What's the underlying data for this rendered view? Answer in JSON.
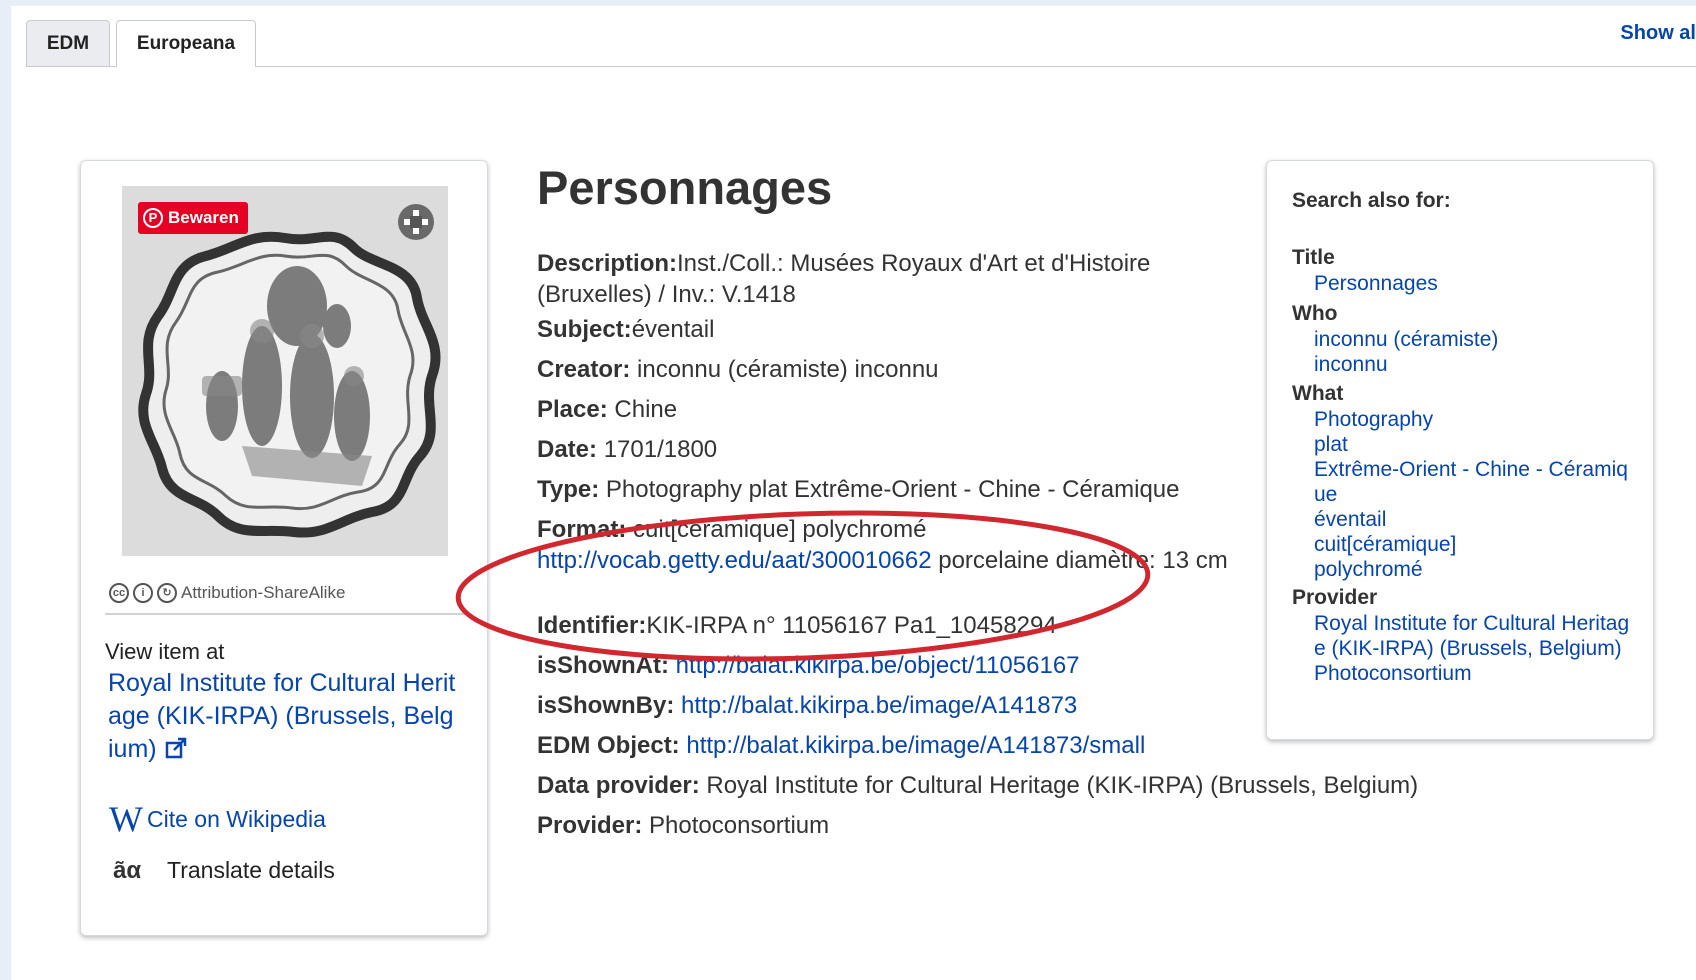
{
  "tabs": [
    {
      "label": "EDM",
      "active": false
    },
    {
      "label": "Europeana",
      "active": true
    }
  ],
  "show_all_label": "Show al",
  "left_card": {
    "pinterest_label": "Bewaren",
    "license_label": "Attribution-ShareAlike",
    "view_item_label": "View item at",
    "provider_link": "Royal Institute for Cultural Heritage (KIK-IRPA) (Brussels, Belgium)",
    "cite_label": "Cite on Wikipedia",
    "translate_label": "Translate details"
  },
  "title": "Personnages",
  "details": {
    "description_label": "Description:",
    "description_value": "Inst./Coll.: Musées Royaux d'Art et d'Histoire (Bruxelles) / Inv.: V.1418",
    "subject_label": "Subject:",
    "subject_value": "éventail",
    "creator_label": "Creator:",
    "creator_value": "inconnu (céramiste) inconnu",
    "place_label": "Place:",
    "place_value": "Chine",
    "date_label": "Date:",
    "date_value": "1701/1800",
    "type_label": "Type:",
    "type_value": "Photography plat Extrême-Orient - Chine - Céramique",
    "format_label": "Format:",
    "format_value": "cuit[céramique] polychromé",
    "format_link": "http://vocab.getty.edu/aat/300010662",
    "format_value2": "porcelaine diamètre: 13 cm",
    "identifier_label": "Identifier:",
    "identifier_value": "KIK-IRPA n° 11056167 Pa1_10458294",
    "isshownat_label": "isShownAt:",
    "isshownat_value": "http://balat.kikirpa.be/object/11056167",
    "isshownby_label": "isShownBy:",
    "isshownby_value": "http://balat.kikirpa.be/image/A141873",
    "edmobject_label": "EDM Object:",
    "edmobject_value": "http://balat.kikirpa.be/image/A141873/small",
    "dataprovider_label": "Data provider:",
    "dataprovider_value": "Royal Institute for Cultural Heritage (KIK-IRPA) (Brussels, Belgium)",
    "provider_label": "Provider:",
    "provider_value": "Photoconsortium"
  },
  "search_also": {
    "heading": "Search also for:",
    "title_heading": "Title",
    "title_items": [
      "Personnages"
    ],
    "who_heading": "Who",
    "who_items": [
      "inconnu (céramiste)",
      "inconnu"
    ],
    "what_heading": "What",
    "what_items": [
      "Photography",
      "plat",
      "Extrême-Orient - Chine - Céramique",
      "éventail",
      "cuit[céramique]",
      "polychromé"
    ],
    "provider_heading": "Provider",
    "provider_items": [
      "Royal Institute for Cultural Heritage (KIK-IRPA) (Brussels, Belgium)",
      "Photoconsortium"
    ]
  },
  "colors": {
    "link": "#0645ad",
    "annotation_circle": "#d0282e",
    "pinterest": "#e60023"
  }
}
